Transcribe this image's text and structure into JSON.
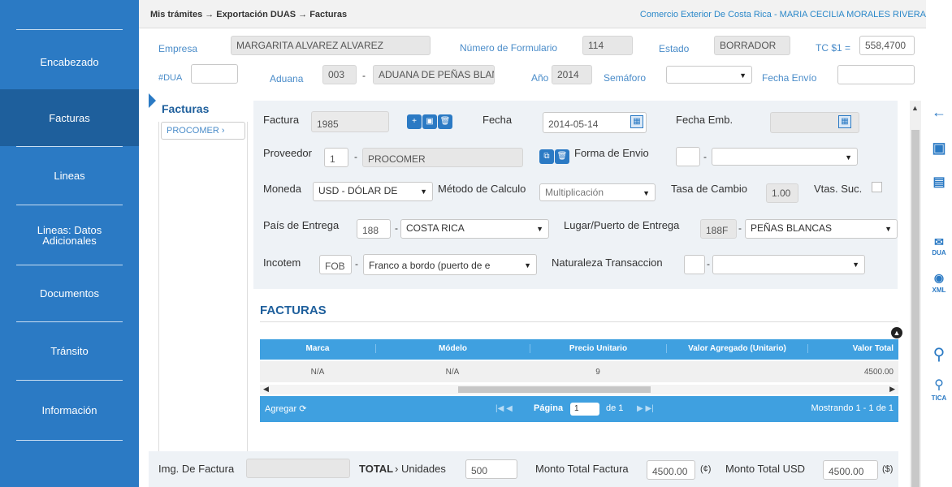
{
  "sidebar": {
    "items": [
      {
        "label": "Encabezado"
      },
      {
        "label": "Facturas",
        "active": true
      },
      {
        "label": "Lineas"
      },
      {
        "label": "Lineas: Datos Adicionales"
      },
      {
        "label": "Documentos"
      },
      {
        "label": "Tránsito"
      },
      {
        "label": "Información"
      }
    ]
  },
  "topbar": {
    "breadcrumb": "Mis trámites → Exportación DUAS → Facturas",
    "user": "Comercio Exterior De Costa Rica - MARIA CECILIA MORALES RIVERA"
  },
  "header": {
    "empresa_label": "Empresa",
    "empresa_value": "MARGARITA ALVAREZ ALVAREZ",
    "num_form_label": "Número de Formulario",
    "num_form_value": "114",
    "estado_label": "Estado",
    "estado_value": "BORRADOR",
    "tc_label": "TC $1 =",
    "tc_value": "558,4700",
    "dua_label": "#DUA",
    "dua_value": "",
    "aduana_label": "Aduana",
    "aduana_code": "003",
    "aduana_name": "ADUANA DE PEÑAS BLANCAS",
    "anio_label": "Año",
    "anio_value": "2014",
    "semaforo_label": "Semáforo",
    "semaforo_value": "",
    "fecha_envio_label": "Fecha Envío",
    "fecha_envio_value": ""
  },
  "facturas_list": {
    "title": "Facturas",
    "items": [
      "PROCOMER"
    ]
  },
  "form": {
    "factura_label": "Factura",
    "factura_value": "1985",
    "fecha_label": "Fecha",
    "fecha_value": "2014-05-14",
    "fecha_emb_label": "Fecha Emb.",
    "fecha_emb_value": "",
    "proveedor_label": "Proveedor",
    "proveedor_code": "1",
    "proveedor_name": "PROCOMER",
    "forma_envio_label": "Forma de Envio",
    "forma_envio_code": "",
    "forma_envio_value": "",
    "moneda_label": "Moneda",
    "moneda_value": "USD - DÓLAR DE",
    "metodo_label": "Método de Calculo",
    "metodo_value": "Multiplicación",
    "tasa_label": "Tasa de Cambio",
    "tasa_value": "1.00",
    "vtas_label": "Vtas. Suc.",
    "pais_label": "País de Entrega",
    "pais_code": "188",
    "pais_value": "COSTA RICA",
    "lugar_label": "Lugar/Puerto de Entrega",
    "lugar_code": "188F",
    "lugar_value": "PEÑAS BLANCAS",
    "incotem_label": "Incotem",
    "incotem_code": "FOB",
    "incotem_value": "Franco a bordo (puerto de e",
    "naturaleza_label": "Naturaleza Transaccion",
    "naturaleza_code": "",
    "naturaleza_value": ""
  },
  "grid": {
    "title": "FACTURAS",
    "columns": [
      "Marca",
      "Módelo",
      "Precio Unitario",
      "Valor Agregado (Unitario)",
      "Valor Total"
    ],
    "rows": [
      {
        "marca": "N/A",
        "modelo": "N/A",
        "precio": "9",
        "valor_agregado": "",
        "valor_total": "4500.00"
      }
    ],
    "add_label": "Agregar",
    "page_label": "Página",
    "page_value": "1",
    "of_label": "de 1",
    "showing_label": "Mostrando 1 - 1 de 1"
  },
  "totals": {
    "img_label": "Img. De Factura",
    "img_value": "",
    "total_label": "TOTAL",
    "unidades_label": "Unidades",
    "unidades_value": "500",
    "monto_label": "Monto Total Factura",
    "monto_value": "4500.00",
    "monto_unit": "(¢)",
    "monto_usd_label": "Monto Total USD",
    "monto_usd_value": "4500.00",
    "monto_usd_unit": "($)"
  },
  "right_toolbar": {
    "dua_label": "DUA",
    "xml_label": "XML",
    "tica_label": "TICA"
  }
}
